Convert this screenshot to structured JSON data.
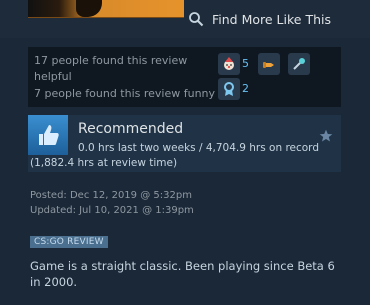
{
  "links": {
    "find_more": "Find More Like This"
  },
  "helpfulness": {
    "helpful_text": "17 people found this review helpful",
    "funny_text": "7 people found this review funny"
  },
  "awards": [
    {
      "icon": "clown-award-icon",
      "count": "5"
    },
    {
      "icon": "hand-award-icon",
      "count": ""
    },
    {
      "icon": "microphone-award-icon",
      "count": ""
    },
    {
      "icon": "medal-award-icon",
      "count": "2"
    }
  ],
  "review": {
    "verdict": "Recommended",
    "hours": "0.0 hrs last two weeks / 4,704.9 hrs on record",
    "hours_at_review": "(1,882.4 hrs at review time)",
    "posted": "Posted: Dec 12, 2019 @ 5:32pm",
    "updated": "Updated: Jul 10, 2021 @ 1:39pm",
    "tag": "CS:GO REVIEW",
    "text": "Game is a straight classic. Been playing since Beta 6 in 2000."
  },
  "colors": {
    "background": "#1b2838",
    "accent": "#66c0f4",
    "recommended_icon": "#3a8fd0"
  }
}
